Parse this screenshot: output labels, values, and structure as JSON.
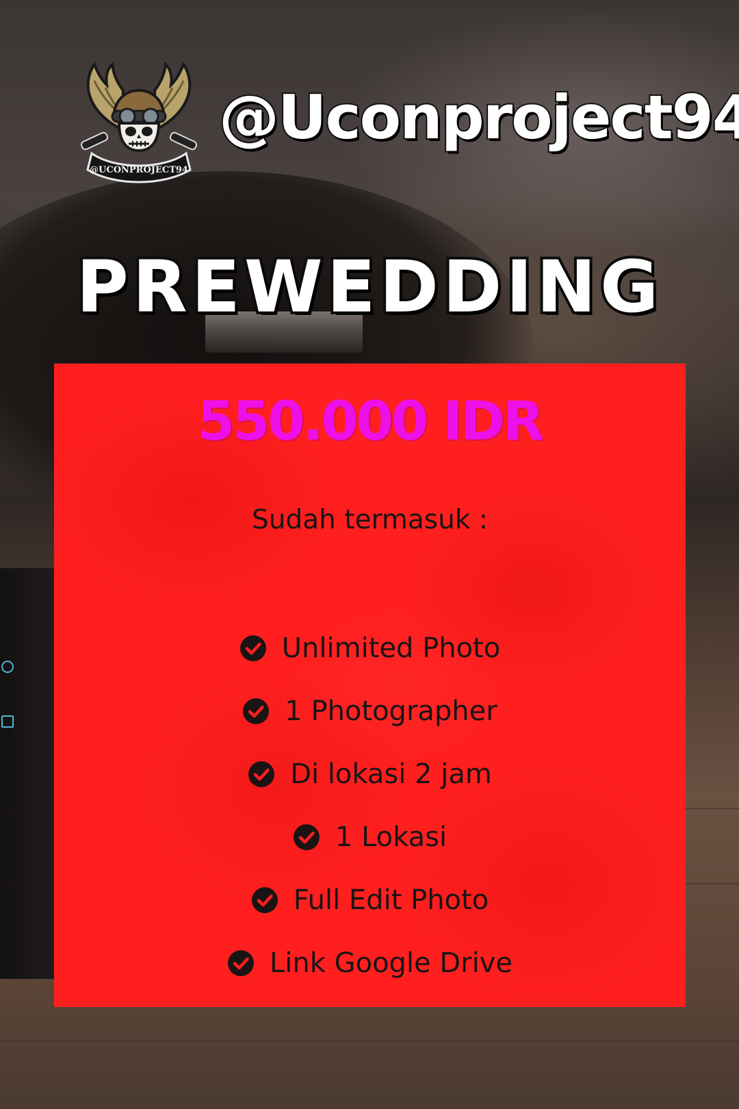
{
  "header": {
    "logo_text": "@UCONPROJECT94",
    "handle": "@Uconproject94"
  },
  "package": {
    "title": "PREWEDDING"
  },
  "card": {
    "price": "550.000 IDR",
    "includes_label": "Sudah termasuk :",
    "features": [
      "Unlimited Photo",
      "1 Photographer",
      "Di lokasi 2 jam",
      "1 Lokasi",
      "Full Edit Photo",
      "Link Google Drive"
    ]
  },
  "icons": {
    "logo": "winged-skull-logo-icon",
    "feature_bullet": "check-circle-icon"
  },
  "colors": {
    "card_background": "#ff1f1f",
    "price_text": "#ee10e8",
    "body_text": "#1a1414",
    "title_fill": "#ffffff",
    "title_outline": "#0d0d0d"
  }
}
